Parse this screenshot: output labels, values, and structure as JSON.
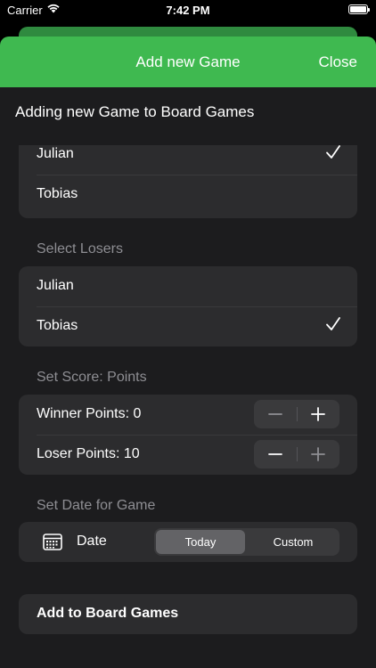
{
  "status_bar": {
    "carrier": "Carrier",
    "time": "7:42 PM"
  },
  "nav": {
    "title": "Add new Game",
    "close_label": "Close"
  },
  "heading": "Adding new Game to Board Games",
  "winners": {
    "items": [
      {
        "label": "Julian",
        "selected": true
      },
      {
        "label": "Tobias",
        "selected": false
      }
    ]
  },
  "losers": {
    "title": "Select Losers",
    "items": [
      {
        "label": "Julian",
        "selected": false
      },
      {
        "label": "Tobias",
        "selected": true
      }
    ]
  },
  "score": {
    "title": "Set Score: Points",
    "winner_label": "Winner Points: 0",
    "loser_label": "Loser Points: 10"
  },
  "date": {
    "title": "Set Date for Game",
    "label": "Date",
    "options": [
      "Today",
      "Custom"
    ],
    "selected": "Today"
  },
  "add_button_label": "Add to Board Games",
  "colors": {
    "accent": "#3fb950",
    "background": "#000000",
    "sheet": "#1c1c1e",
    "cell": "#2c2c2e",
    "secondary_text": "#8e8e93"
  }
}
